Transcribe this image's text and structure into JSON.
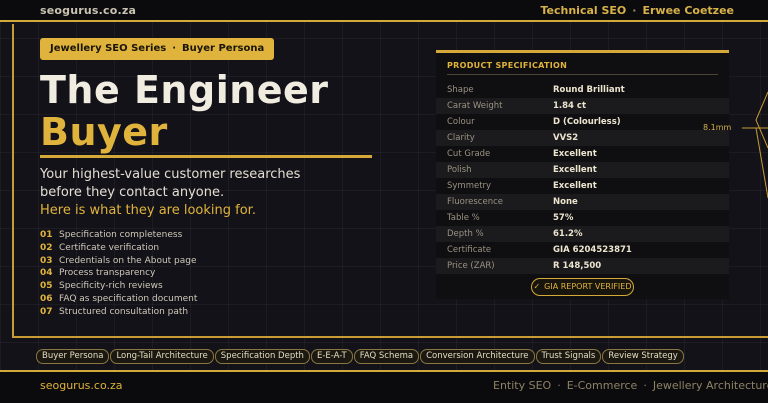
{
  "topbar": {
    "site": "seogurus.co.za",
    "right_primary": "Technical SEO",
    "right_separator": "·",
    "right_secondary": "Erwee Coetzee"
  },
  "hero": {
    "pill_series": "Jewellery SEO Series",
    "pill_separator": "·",
    "pill_topic": "Buyer Persona",
    "title_line1": "The Engineer",
    "title_line2": "Buyer",
    "subtitle": "Your highest-value customer researches before they contact anyone.",
    "subtitle_highlight": "Here is what they are looking for."
  },
  "list": [
    {
      "num": "01",
      "text": "Specification completeness"
    },
    {
      "num": "02",
      "text": "Certificate verification"
    },
    {
      "num": "03",
      "text": "Credentials on the About page"
    },
    {
      "num": "04",
      "text": "Process transparency"
    },
    {
      "num": "05",
      "text": "Specificity-rich reviews"
    },
    {
      "num": "06",
      "text": "FAQ as specification document"
    },
    {
      "num": "07",
      "text": "Structured consultation path"
    }
  ],
  "spec": {
    "header": "PRODUCT SPECIFICATION",
    "rows": [
      {
        "key": "Shape",
        "value": "Round Brilliant"
      },
      {
        "key": "Carat Weight",
        "value": "1.84 ct"
      },
      {
        "key": "Colour",
        "value": "D  (Colourless)"
      },
      {
        "key": "Clarity",
        "value": "VVS2"
      },
      {
        "key": "Cut Grade",
        "value": "Excellent"
      },
      {
        "key": "Polish",
        "value": "Excellent"
      },
      {
        "key": "Symmetry",
        "value": "Excellent"
      },
      {
        "key": "Fluorescence",
        "value": "None"
      },
      {
        "key": "Table %",
        "value": "57%"
      },
      {
        "key": "Depth %",
        "value": "61.2%"
      },
      {
        "key": "Certificate",
        "value": "GIA  6204523871"
      },
      {
        "key": "Price (ZAR)",
        "value": "R 148,500"
      }
    ],
    "badge_check": "✓",
    "badge_label": "GIA REPORT VERIFIED",
    "diamond_dimension": "8.1mm"
  },
  "tags": [
    "Buyer Persona",
    "Long-Tail Architecture",
    "Specification Depth",
    "E-E-A-T",
    "FAQ Schema",
    "Conversion Architecture",
    "Trust Signals",
    "Review Strategy"
  ],
  "footer": {
    "site": "seogurus.co.za",
    "topics": [
      "Entity SEO",
      "E-Commerce",
      "Jewellery Architecture"
    ],
    "separator": "·"
  },
  "colors": {
    "accent": "#d4a93a",
    "background": "#131219",
    "text": "#e9e4d6"
  },
  "icons": [
    "check-icon",
    "diamond-icon"
  ]
}
